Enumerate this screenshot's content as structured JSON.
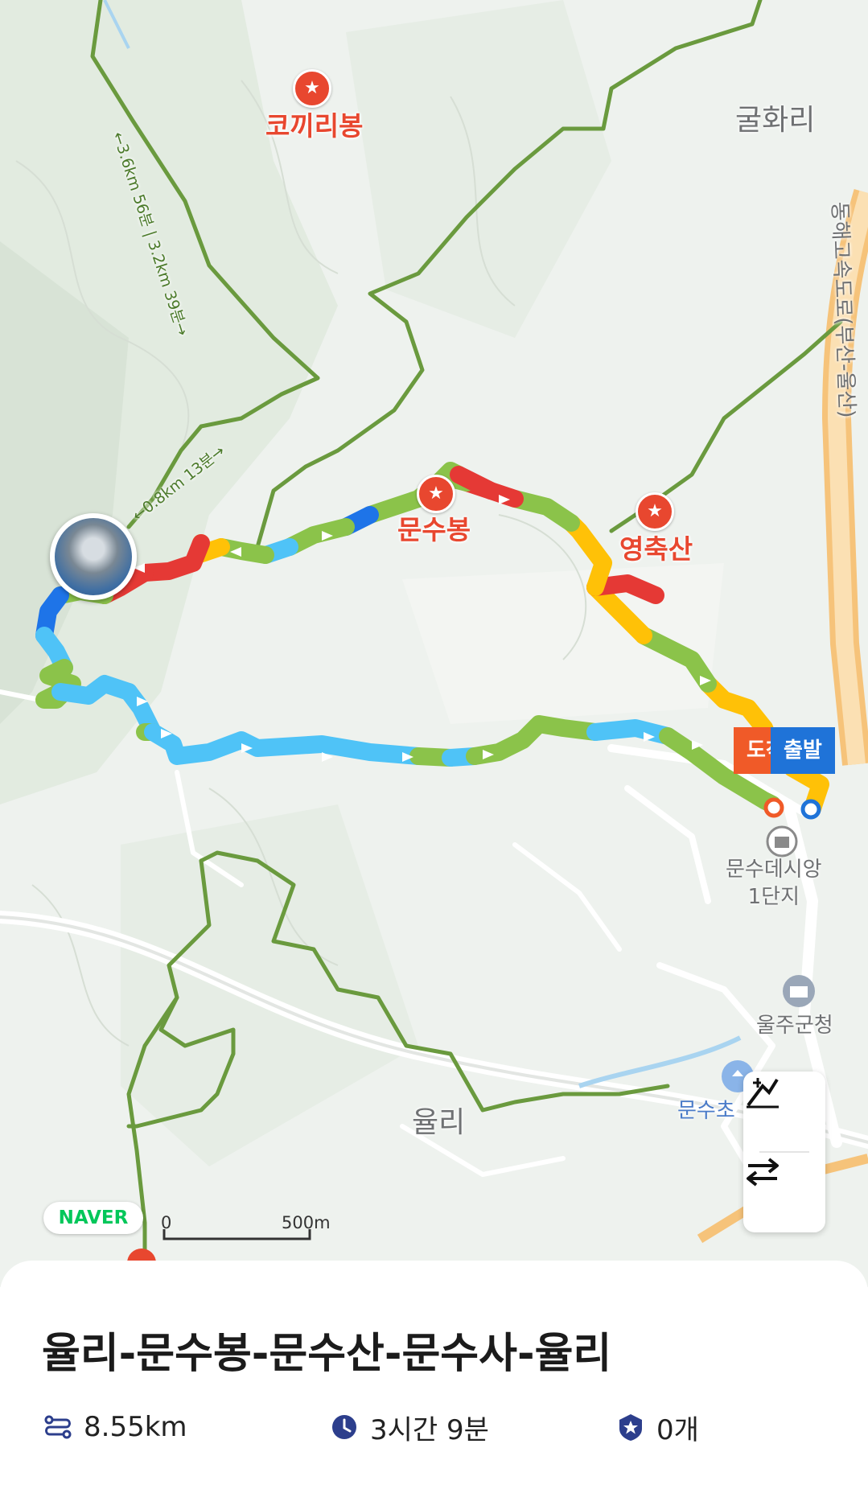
{
  "map": {
    "peaks": [
      {
        "name": "코끼리봉"
      },
      {
        "name": "문수봉"
      },
      {
        "name": "영축산"
      }
    ],
    "places": {
      "gulhwa": "굴화리",
      "yul": "율리",
      "apt_line1": "문수데시앙",
      "apt_line2": "1단지",
      "county_office": "울주군청",
      "school": "문수초",
      "highway": "동해고속도로(부산-울산)"
    },
    "trail_labels": {
      "upper": "←3.6km 56분 | 3.2km 39분→",
      "lower": "←0.8km 13분→"
    },
    "badges": {
      "arrival": "도착",
      "start": "출발"
    },
    "scale": {
      "zero": "0",
      "distance": "500m"
    },
    "naver_logo": "NAVER",
    "controls": [
      {
        "icon": "slope-chart-icon"
      },
      {
        "icon": "swap-arrows-icon"
      }
    ],
    "colors": {
      "trail": "#6a9a3e",
      "route_blue": "#4fc3f7",
      "route_green": "#8bc34a",
      "route_yellow": "#ffc107",
      "route_red": "#e53935",
      "route_darkblue": "#1e74e8",
      "poi": "#e8472f",
      "start_badge": "#1f73d8",
      "arrival_badge": "#f05a28"
    }
  },
  "course": {
    "title": "율리-문수봉-문수산-문수사-율리",
    "distance": "8.55km",
    "duration": "3시간 9분",
    "certified_peaks": "0개"
  }
}
